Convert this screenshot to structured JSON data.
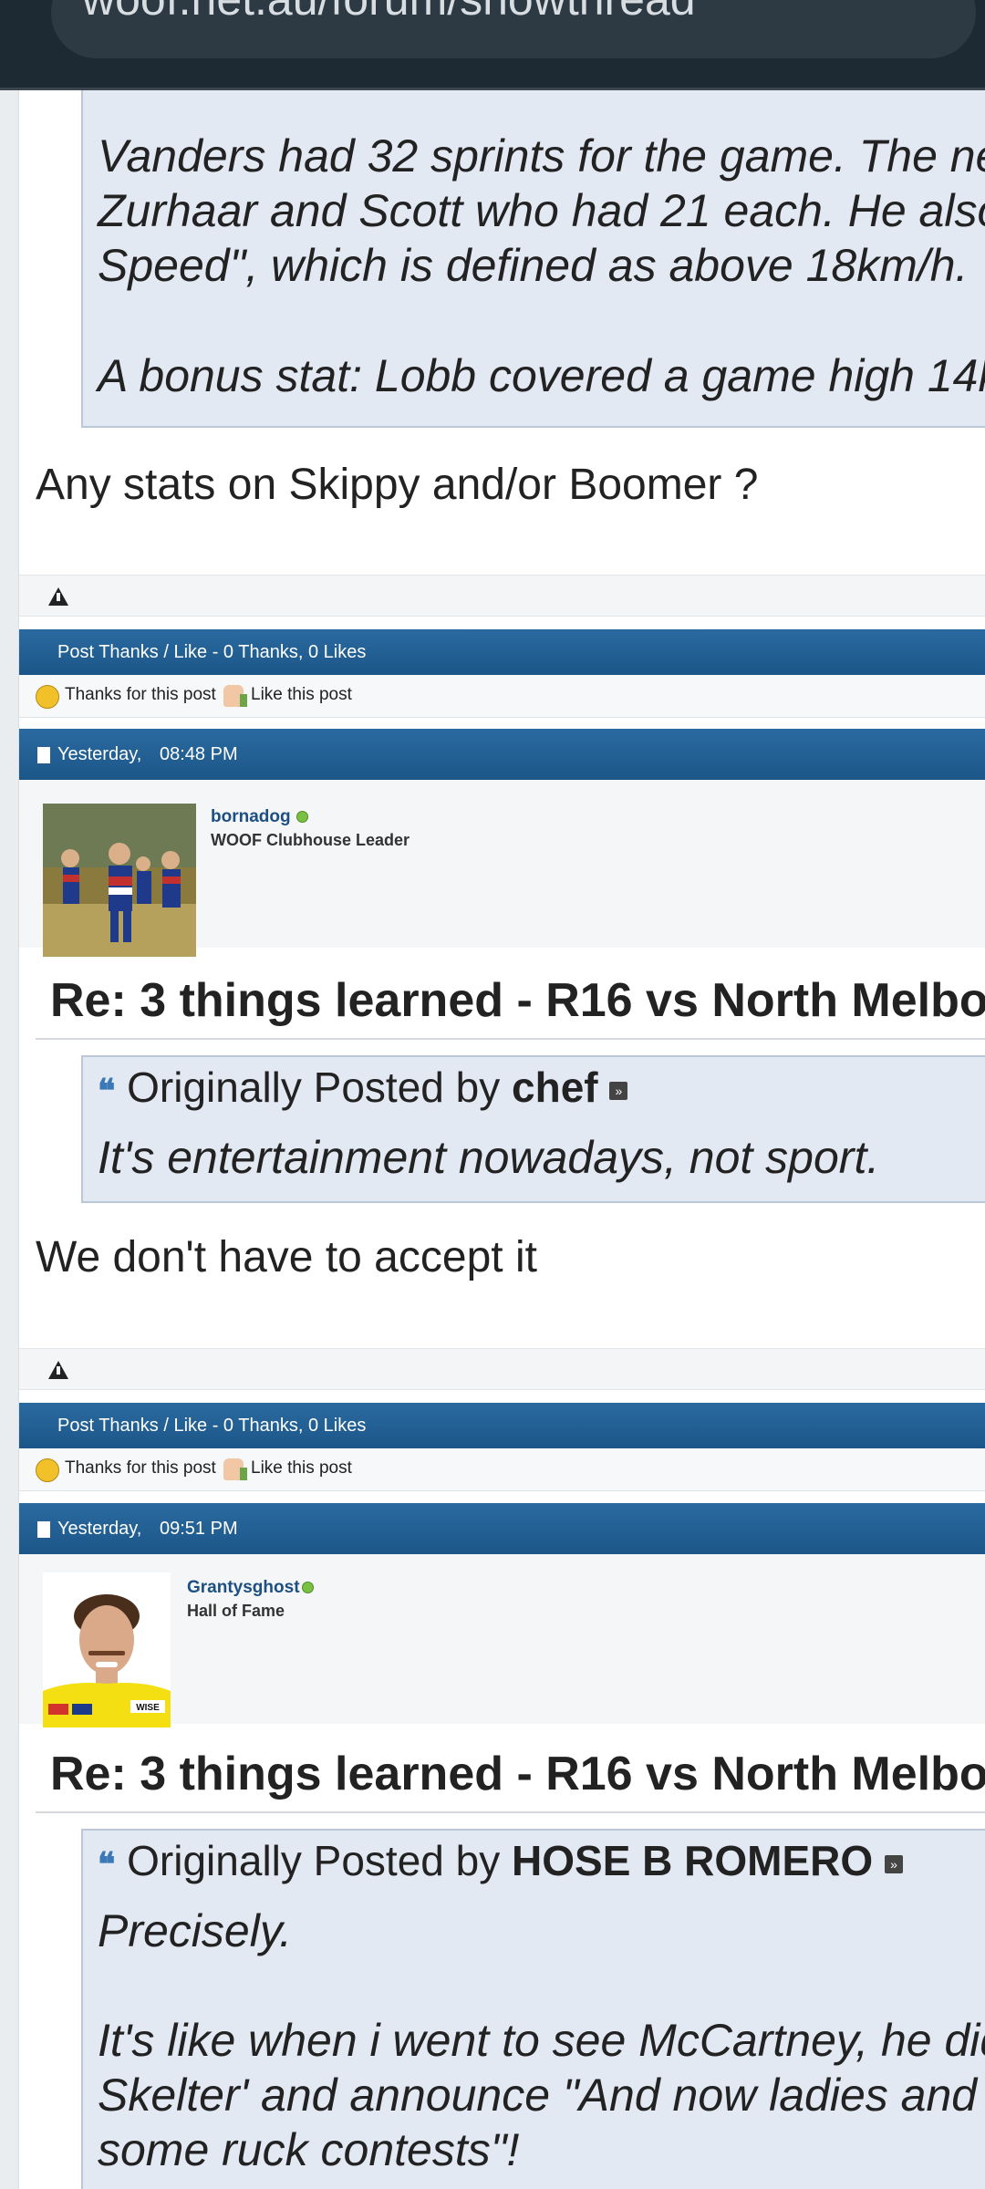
{
  "browser": {
    "url": "woof.net.au/forum/showthread"
  },
  "posts": [
    {
      "quote_lines": [
        "Vanders had 32 sprints for the game. The ne",
        "Zurhaar and Scott who had 21 each. He also",
        "Speed\", which is defined as above 18km/h.",
        "A bonus stat: Lobb covered a game high 14k"
      ],
      "body": "Any stats on Skippy and/or Boomer ?",
      "thanks_header": "Post Thanks / Like - 0 Thanks, 0 Likes",
      "thanks_label": "Thanks for this post",
      "like_label": "Like this post"
    },
    {
      "date": "Yesterday,",
      "time": "08:48 PM",
      "username": "bornadog",
      "user_title": "WOOF Clubhouse Leader",
      "title": "Re: 3 things learned - R16 vs North Melbo",
      "quote_prefix": "Originally Posted by",
      "quote_author": "chef",
      "quote_lines": [
        "It's entertainment nowadays, not sport."
      ],
      "body": "We don't have to accept it",
      "thanks_header": "Post Thanks / Like - 0 Thanks, 0 Likes",
      "thanks_label": "Thanks for this post",
      "like_label": "Like this post"
    },
    {
      "date": "Yesterday,",
      "time": "09:51 PM",
      "username": "Grantysghost",
      "user_title": "Hall of Fame",
      "title": "Re: 3 things learned - R16 vs North Melbo",
      "quote_prefix": "Originally Posted by",
      "quote_author": "HOSE B ROMERO",
      "quote_lines": [
        "Precisely.",
        "It's like when i went to see McCartney, he did",
        "Skelter' and announce \"And now ladies and g",
        "some ruck contests\"!"
      ],
      "avatar_text": "WISE"
    }
  ],
  "icons": {
    "warning": "warning-triangle-icon",
    "thanks": "smiley-thanks-icon",
    "like": "thumbs-up-icon",
    "doc": "post-document-icon",
    "quote": "quote-marks-icon",
    "view_post": "view-post-arrow-icon",
    "online": "online-status-icon"
  },
  "colors": {
    "bar_blue": "#1c5688",
    "quote_bg": "#e3e9f2",
    "username": "#1d4f82",
    "online": "#7ac142"
  }
}
